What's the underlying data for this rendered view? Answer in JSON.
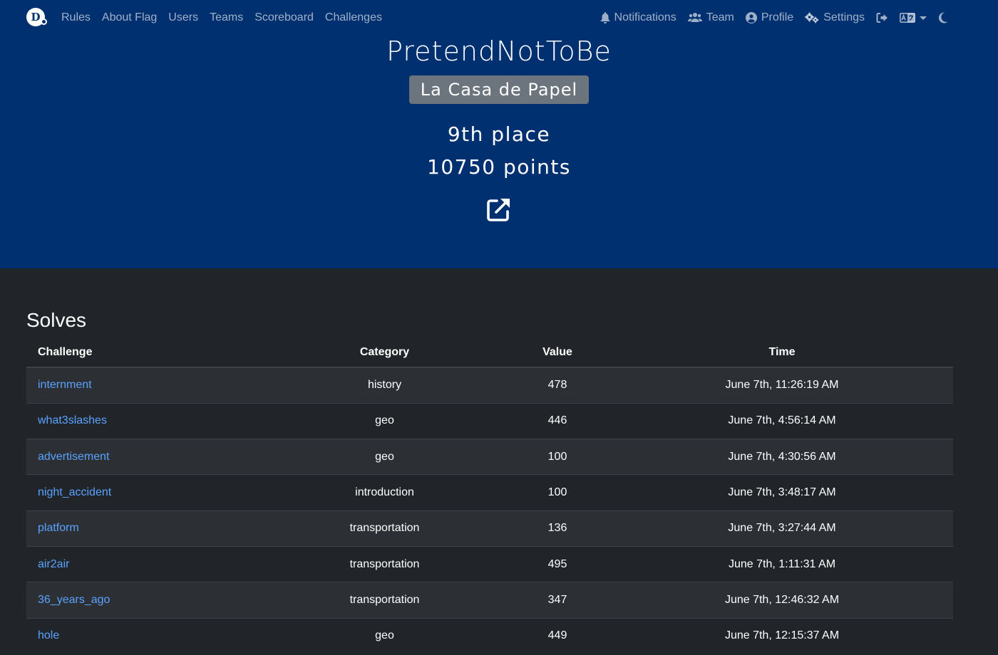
{
  "nav": {
    "brand_letter": "D",
    "links": [
      "Rules",
      "About Flag",
      "Users",
      "Teams",
      "Scoreboard",
      "Challenges"
    ],
    "notifications": "Notifications",
    "team": "Team",
    "profile": "Profile",
    "settings": "Settings"
  },
  "team": {
    "name": "PretendNotToBe",
    "affiliation": "La Casa de Papel",
    "place": "9th place",
    "points": "10750 points"
  },
  "solves": {
    "title": "Solves",
    "columns": [
      "Challenge",
      "Category",
      "Value",
      "Time"
    ],
    "rows": [
      {
        "challenge": "internment",
        "category": "history",
        "value": "478",
        "time": "June 7th, 11:26:19 AM"
      },
      {
        "challenge": "what3slashes",
        "category": "geo",
        "value": "446",
        "time": "June 7th, 4:56:14 AM"
      },
      {
        "challenge": "advertisement",
        "category": "geo",
        "value": "100",
        "time": "June 7th, 4:30:56 AM"
      },
      {
        "challenge": "night_accident",
        "category": "introduction",
        "value": "100",
        "time": "June 7th, 3:48:17 AM"
      },
      {
        "challenge": "platform",
        "category": "transportation",
        "value": "136",
        "time": "June 7th, 3:27:44 AM"
      },
      {
        "challenge": "air2air",
        "category": "transportation",
        "value": "495",
        "time": "June 7th, 1:11:31 AM"
      },
      {
        "challenge": "36_years_ago",
        "category": "transportation",
        "value": "347",
        "time": "June 7th, 12:46:32 AM"
      },
      {
        "challenge": "hole",
        "category": "geo",
        "value": "449",
        "time": "June 7th, 12:15:37 AM"
      }
    ]
  },
  "colors": {
    "header_bg": "#003070",
    "page_bg": "#212529",
    "link": "#5aa2ff",
    "badge": "#6c757d"
  },
  "icons": [
    "bell-icon",
    "users-icon",
    "user-circle-icon",
    "cogs-icon",
    "sign-out-icon",
    "language-icon",
    "moon-icon",
    "external-link-icon"
  ]
}
